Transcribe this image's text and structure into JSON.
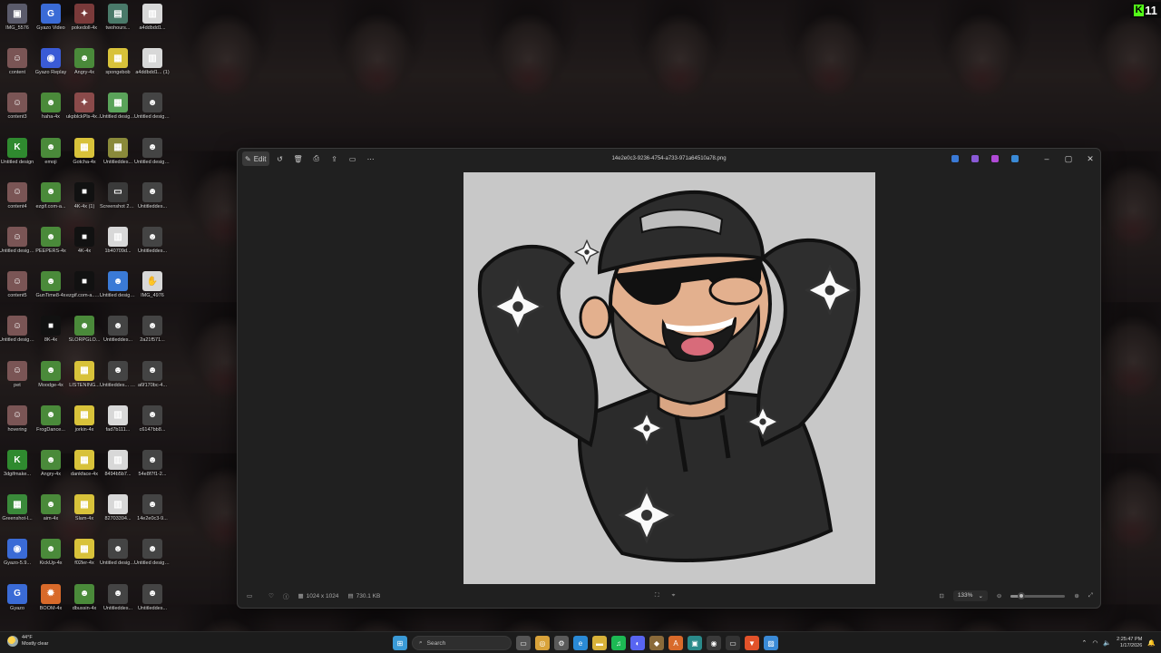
{
  "desktop": {
    "icons": [
      {
        "label": "IMG_5576",
        "color": "#5b5b6b",
        "glyph": "▣"
      },
      {
        "label": "Gyazo Video",
        "color": "#3a6bd6",
        "glyph": "G"
      },
      {
        "label": "pokedoll-4x",
        "color": "#7a3a3a",
        "glyph": "✦"
      },
      {
        "label": "twohours...",
        "color": "#4a7a6a",
        "glyph": "▤"
      },
      {
        "label": "a4ddbdd1...",
        "color": "#d8d8d8",
        "glyph": "▥"
      },
      {
        "label": "content",
        "color": "#7a5555",
        "glyph": "☺"
      },
      {
        "label": "Gyazo Replay",
        "color": "#3a5bd6",
        "glyph": "◉"
      },
      {
        "label": "Angry-4x",
        "color": "#4a8a3a",
        "glyph": "☻"
      },
      {
        "label": "spongebob",
        "color": "#d8c23a",
        "glyph": "▦"
      },
      {
        "label": "a4ddbdd1... (1)",
        "color": "#d8d8d8",
        "glyph": "▥"
      },
      {
        "label": "content3",
        "color": "#7a5555",
        "glyph": "☺"
      },
      {
        "label": "haha-4x",
        "color": "#4a8a3a",
        "glyph": "☻"
      },
      {
        "label": "ukpblckPls-4x (1)",
        "color": "#8a4a4a",
        "glyph": "✦"
      },
      {
        "label": "Untitled design (3)",
        "color": "#5aa35a",
        "glyph": "▦"
      },
      {
        "label": "Untitled design (8)",
        "color": "#444",
        "glyph": "☻"
      },
      {
        "label": "Untitled design",
        "color": "#2f8a2f",
        "glyph": "K"
      },
      {
        "label": "emoji",
        "color": "#4a8a3a",
        "glyph": "☻"
      },
      {
        "label": "Gotcha-4x",
        "color": "#d8c23a",
        "glyph": "▦"
      },
      {
        "label": "Untitleddes...",
        "color": "#8a8a3a",
        "glyph": "▦"
      },
      {
        "label": "Untitled design (7)",
        "color": "#444",
        "glyph": "☻"
      },
      {
        "label": "content4",
        "color": "#7a5555",
        "glyph": "☺"
      },
      {
        "label": "ezgif.com-a...",
        "color": "#4a8a3a",
        "glyph": "☻"
      },
      {
        "label": "4K-4x (1)",
        "color": "#111",
        "glyph": "■"
      },
      {
        "label": "Screenshot 2026-01-...",
        "color": "#3a3a3a",
        "glyph": "▭"
      },
      {
        "label": "Untitleddes...",
        "color": "#444",
        "glyph": "☻"
      },
      {
        "label": "Untitled design (1)",
        "color": "#7a5555",
        "glyph": "☺"
      },
      {
        "label": "PEEPERS-4x",
        "color": "#4a8a3a",
        "glyph": "☻"
      },
      {
        "label": "4K-4x",
        "color": "#111",
        "glyph": "■"
      },
      {
        "label": "1b40709d...",
        "color": "#d8d8d8",
        "glyph": "▥"
      },
      {
        "label": "Untitleddes...",
        "color": "#444",
        "glyph": "☻"
      },
      {
        "label": "content5",
        "color": "#7a5555",
        "glyph": "☺"
      },
      {
        "label": "GunTime8-4x",
        "color": "#4a8a3a",
        "glyph": "☻"
      },
      {
        "label": "ezgif.com-a... (1)",
        "color": "#111",
        "glyph": "■"
      },
      {
        "label": "Untitled design (4)",
        "color": "#3a7ad6",
        "glyph": "☻"
      },
      {
        "label": "IMG_4976",
        "color": "#d8d8d8",
        "glyph": "✋"
      },
      {
        "label": "Untitled design (2)",
        "color": "#7a5555",
        "glyph": "☺"
      },
      {
        "label": "8K-4x",
        "color": "#111",
        "glyph": "■"
      },
      {
        "label": "SLORPGLO...",
        "color": "#4a8a3a",
        "glyph": "☻"
      },
      {
        "label": "Untitleddes...",
        "color": "#444",
        "glyph": "☻"
      },
      {
        "label": "2a21f571...",
        "color": "#444",
        "glyph": "☻"
      },
      {
        "label": "pet",
        "color": "#7a5555",
        "glyph": "☺"
      },
      {
        "label": "Moodge-4x",
        "color": "#4a8a3a",
        "glyph": "☻"
      },
      {
        "label": "LISTENING...",
        "color": "#d8c23a",
        "glyph": "▦"
      },
      {
        "label": "Untitleddes... (1)",
        "color": "#444",
        "glyph": "☻"
      },
      {
        "label": "a6f170bc-4...",
        "color": "#444",
        "glyph": "☻"
      },
      {
        "label": "hovering",
        "color": "#7a5555",
        "glyph": "☺"
      },
      {
        "label": "FrogDance...",
        "color": "#4a8a3a",
        "glyph": "☻"
      },
      {
        "label": "jorkin-4x",
        "color": "#d8c23a",
        "glyph": "▦"
      },
      {
        "label": "fad7b111...",
        "color": "#d8d8d8",
        "glyph": "▥"
      },
      {
        "label": "c6147bb8...",
        "color": "#444",
        "glyph": "☻"
      },
      {
        "label": "3dgifmake...",
        "color": "#2f8a2f",
        "glyph": "K"
      },
      {
        "label": "Angry-4x",
        "color": "#4a8a3a",
        "glyph": "☻"
      },
      {
        "label": "dankface-4x",
        "color": "#d8c23a",
        "glyph": "▦"
      },
      {
        "label": "8494b5b7...",
        "color": "#d8d8d8",
        "glyph": "▥"
      },
      {
        "label": "54e8f7f1-2...",
        "color": "#444",
        "glyph": "☻"
      },
      {
        "label": "Greenshot-l...",
        "color": "#3a8a3a",
        "glyph": "▦"
      },
      {
        "label": "aim-4x",
        "color": "#4a8a3a",
        "glyph": "☻"
      },
      {
        "label": "Slam-4x",
        "color": "#d8c23a",
        "glyph": "▦"
      },
      {
        "label": "82703394...",
        "color": "#d8d8d8",
        "glyph": "▥"
      },
      {
        "label": "14e2e0c3-9...",
        "color": "#444",
        "glyph": "☻"
      },
      {
        "label": "Gyazo-5.9...",
        "color": "#3a6bd6",
        "glyph": "◉"
      },
      {
        "label": "KickUp-4x",
        "color": "#4a8a3a",
        "glyph": "☻"
      },
      {
        "label": "f02ler-4x",
        "color": "#d8c23a",
        "glyph": "▦"
      },
      {
        "label": "Untitled design (5)",
        "color": "#444",
        "glyph": "☻"
      },
      {
        "label": "Untitled design (9)",
        "color": "#444",
        "glyph": "☻"
      },
      {
        "label": "Gyazo",
        "color": "#3a6bd6",
        "glyph": "G"
      },
      {
        "label": "BOOM-4x",
        "color": "#d86a2a",
        "glyph": "✹"
      },
      {
        "label": "dbussin-4x",
        "color": "#4a8a3a",
        "glyph": "☻"
      },
      {
        "label": "Untitleddes...",
        "color": "#444",
        "glyph": "☻"
      },
      {
        "label": "Untitleddes...",
        "color": "#444",
        "glyph": "☻"
      }
    ]
  },
  "kick_badge": {
    "letter": "K",
    "number": "11",
    "color": "#53fc18"
  },
  "photos": {
    "file_name": "14e2e0c3-9236-4754-a733-971a64510a78.png",
    "edit_label": "Edit",
    "zoom_level": "133%",
    "zoom_fraction": 0.2,
    "dimensions": "1024 x 1024",
    "file_size": "730.1 KB",
    "toolbar_icons": [
      "edit-icon",
      "rotate-icon",
      "delete-icon",
      "print-icon",
      "share-icon",
      "info-panel-icon",
      "more-icon"
    ],
    "title_apps": [
      {
        "name": "app-icon-1",
        "color": "#3a7ad6"
      },
      {
        "name": "app-icon-2",
        "color": "#8a5ad6"
      },
      {
        "name": "app-icon-3",
        "color": "#b04ad6"
      },
      {
        "name": "onedrive-icon",
        "color": "#3a8ad6"
      }
    ]
  },
  "taskbar": {
    "weather_temp": "44°F",
    "weather_desc": "Mostly clear",
    "search_placeholder": "Search",
    "time": "2:25:47 PM",
    "date": "1/17/2026",
    "apps": [
      {
        "name": "start-icon",
        "color": "#3a9ad6",
        "glyph": "⊞"
      },
      {
        "name": "task-view-icon",
        "color": "#555",
        "glyph": "▭"
      },
      {
        "name": "chrome-icon",
        "color": "#d8a23a",
        "glyph": "◎"
      },
      {
        "name": "settings-icon",
        "color": "#5a5a5a",
        "glyph": "⚙"
      },
      {
        "name": "edge-icon",
        "color": "#2a8ad6",
        "glyph": "e"
      },
      {
        "name": "files-icon",
        "color": "#d8b23a",
        "glyph": "▬"
      },
      {
        "name": "spotify-icon",
        "color": "#1db954",
        "glyph": "♫"
      },
      {
        "name": "discord-icon",
        "color": "#5865f2",
        "glyph": "◐"
      },
      {
        "name": "app-icon-a",
        "color": "#8a6a3a",
        "glyph": "◆"
      },
      {
        "name": "app-icon-b",
        "color": "#d86a2a",
        "glyph": "A"
      },
      {
        "name": "app-icon-c",
        "color": "#2a8a8a",
        "glyph": "▣"
      },
      {
        "name": "obs-icon",
        "color": "#3a3a3a",
        "glyph": "◉"
      },
      {
        "name": "terminal-icon",
        "color": "#333",
        "glyph": "▭"
      },
      {
        "name": "brave-icon",
        "color": "#e2522a",
        "glyph": "▼"
      },
      {
        "name": "photos-icon",
        "color": "#3a8ad6",
        "glyph": "▨"
      }
    ]
  }
}
